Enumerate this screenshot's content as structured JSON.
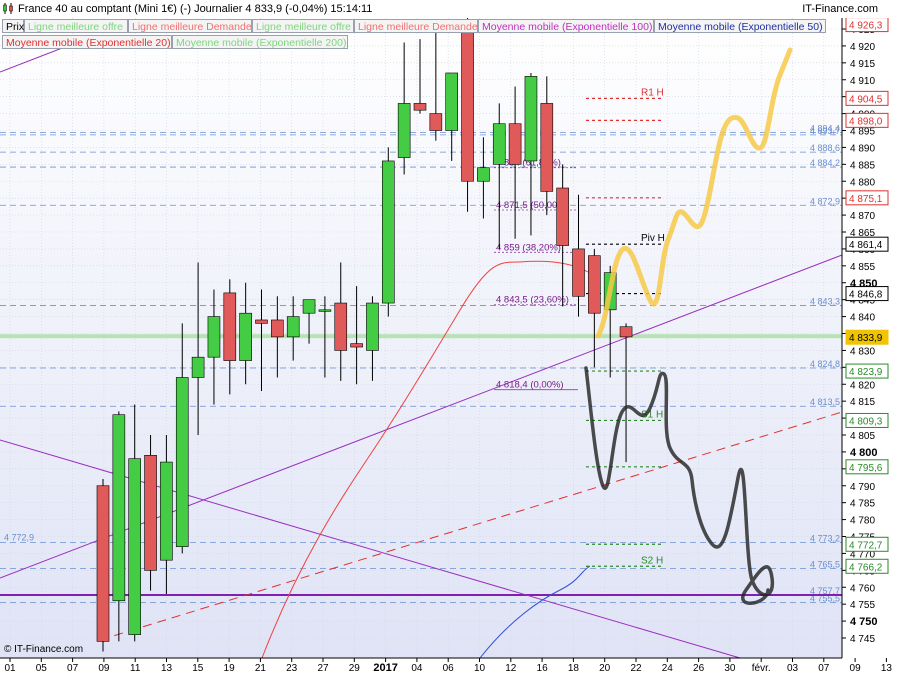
{
  "header": {
    "title": "France 40 au comptant (Mini 1€) (-)   Journalier   4 833,9 (-0,04%)   15:14:11",
    "brand": "IT-Finance.com",
    "copyright": "© IT-Finance.com"
  },
  "legend": [
    {
      "label": "Prix",
      "color": "#000000"
    },
    {
      "label": "Ligne meilleure offre",
      "color": "#7cd67c"
    },
    {
      "label": "Ligne meilleure Demande",
      "color": "#f07070"
    },
    {
      "label": "Ligne meilleure offre",
      "color": "#7cd67c"
    },
    {
      "label": "Ligne meilleure Demande",
      "color": "#f07070"
    },
    {
      "label": "Moyenne mobile (Exponentielle 100)",
      "color": "#c030c0"
    },
    {
      "label": "Moyenne mobile (Exponentielle 50)",
      "color": "#2030a0"
    },
    {
      "label": "Moyenne mobile (Exponentielle 20)",
      "color": "#e03030"
    },
    {
      "label": "Moyenne mobile (Exponentielle 200)",
      "color": "#7cd67c"
    }
  ],
  "chart_data": {
    "type": "candlestick",
    "ylim": [
      4741,
      4929
    ],
    "y_ticks": [
      4745,
      4750,
      4755,
      4760,
      4765,
      4770,
      4775,
      4780,
      4785,
      4790,
      4795,
      4800,
      4805,
      4810,
      4815,
      4820,
      4825,
      4830,
      4835,
      4840,
      4845,
      4850,
      4855,
      4860,
      4865,
      4870,
      4875,
      4880,
      4885,
      4890,
      4895,
      4900,
      4905,
      4910,
      4915,
      4920,
      4925
    ],
    "y_ticks_bold": [
      4750,
      4800,
      4850
    ],
    "x_ticks": [
      "01",
      "05",
      "07",
      "09",
      "11",
      "13",
      "15",
      "19",
      "21",
      "23",
      "27",
      "29",
      "2017",
      "04",
      "06",
      "10",
      "12",
      "16",
      "18",
      "20",
      "22",
      "24",
      "26",
      "30",
      "févr.",
      "03",
      "07",
      "09",
      "13"
    ],
    "candles": [
      {
        "o": 4790,
        "h": 4792,
        "l": 4741,
        "c": 4744
      },
      {
        "o": 4756,
        "h": 4812,
        "l": 4744,
        "c": 4811
      },
      {
        "o": 4746,
        "h": 4814,
        "l": 4744,
        "c": 4798
      },
      {
        "o": 4799,
        "h": 4805,
        "l": 4759,
        "c": 4765
      },
      {
        "o": 4768,
        "h": 4805,
        "l": 4758,
        "c": 4797
      },
      {
        "o": 4772,
        "h": 4838,
        "l": 4770,
        "c": 4822
      },
      {
        "o": 4822,
        "h": 4856,
        "l": 4805,
        "c": 4828
      },
      {
        "o": 4828,
        "h": 4848,
        "l": 4814,
        "c": 4840
      },
      {
        "o": 4847,
        "h": 4851,
        "l": 4817,
        "c": 4827
      },
      {
        "o": 4827,
        "h": 4850,
        "l": 4820,
        "c": 4841
      },
      {
        "o": 4839,
        "h": 4848,
        "l": 4818,
        "c": 4838
      },
      {
        "o": 4839,
        "h": 4846,
        "l": 4822,
        "c": 4834
      },
      {
        "o": 4834,
        "h": 4846,
        "l": 4827,
        "c": 4840
      },
      {
        "o": 4841,
        "h": 4844,
        "l": 4832,
        "c": 4845
      },
      {
        "o": 4842,
        "h": 4846,
        "l": 4822,
        "c": 4842
      },
      {
        "o": 4844,
        "h": 4856,
        "l": 4821,
        "c": 4830
      },
      {
        "o": 4832,
        "h": 4849,
        "l": 4820,
        "c": 4831
      },
      {
        "o": 4830,
        "h": 4846,
        "l": 4821,
        "c": 4844
      },
      {
        "o": 4844,
        "h": 4890,
        "l": 4840,
        "c": 4886
      },
      {
        "o": 4887,
        "h": 4921,
        "l": 4882,
        "c": 4903
      },
      {
        "o": 4903,
        "h": 4922,
        "l": 4900,
        "c": 4901
      },
      {
        "o": 4900,
        "h": 4926,
        "l": 4892,
        "c": 4895
      },
      {
        "o": 4895,
        "h": 4911,
        "l": 4886,
        "c": 4912
      },
      {
        "o": 4926,
        "h": 4930,
        "l": 4871,
        "c": 4880
      },
      {
        "o": 4880,
        "h": 4893,
        "l": 4869,
        "c": 4884
      },
      {
        "o": 4885,
        "h": 4903,
        "l": 4860,
        "c": 4897
      },
      {
        "o": 4897,
        "h": 4908,
        "l": 4863,
        "c": 4885
      },
      {
        "o": 4886,
        "h": 4912,
        "l": 4864,
        "c": 4911
      },
      {
        "o": 4903,
        "h": 4911,
        "l": 4870,
        "c": 4877
      },
      {
        "o": 4878,
        "h": 4885,
        "l": 4843,
        "c": 4861
      },
      {
        "o": 4860,
        "h": 4876,
        "l": 4840,
        "c": 4846
      },
      {
        "o": 4858,
        "h": 4860,
        "l": 4825,
        "c": 4841
      },
      {
        "o": 4842,
        "h": 4855,
        "l": 4822,
        "c": 4853
      },
      {
        "o": 4837,
        "h": 4838,
        "l": 4797,
        "c": 4834
      }
    ],
    "hlines": [
      {
        "value": 4894.4,
        "label": "4 894,4",
        "color": "#6a8fd0"
      },
      {
        "value": 4893.7,
        "label": "4 893,7",
        "color": "#6a8fd0"
      },
      {
        "value": 4888.6,
        "label": "4 888,6",
        "color": "#6a8fd0"
      },
      {
        "value": 4884.2,
        "label": "4 884,2",
        "color": "#6a8fd0"
      },
      {
        "value": 4872.9,
        "label": "4 872,9",
        "color": "#6a8fd0"
      },
      {
        "value": 4843.3,
        "label": "4 843,3",
        "color": "#6a8fd0"
      },
      {
        "value": 4824.8,
        "label": "4 824,8",
        "color": "#6a8fd0"
      },
      {
        "value": 4813.5,
        "label": "4 813,5",
        "color": "#6a8fd0"
      },
      {
        "value": 4773.2,
        "label": "4 773,2",
        "color": "#6a8fd0"
      },
      {
        "value": 4765.5,
        "label": "4 765,5",
        "color": "#6a8fd0"
      },
      {
        "value": 4757.7,
        "label": "4 757,7",
        "color": "#6a8fd0"
      },
      {
        "value": 4755.5,
        "label": "4 755,5",
        "color": "#6a8fd0"
      }
    ],
    "left_label": {
      "value": 4772.9,
      "label": "4 772,9"
    },
    "price_tags": [
      {
        "value": 4926.3,
        "label": "4 926,3",
        "color": "#e03030"
      },
      {
        "value": 4904.5,
        "label": "4 904,5",
        "color": "#e03030"
      },
      {
        "value": 4898.0,
        "label": "4 898,0",
        "color": "#e03030"
      },
      {
        "value": 4875.1,
        "label": "4 875,1",
        "color": "#e03030"
      },
      {
        "value": 4861.4,
        "label": "4 861,4",
        "color": "#000000"
      },
      {
        "value": 4846.8,
        "label": "4 846,8",
        "color": "#000000"
      },
      {
        "value": 4833.9,
        "label": "4 833,9",
        "color": "#f0c400"
      },
      {
        "value": 4823.9,
        "label": "4 823,9",
        "color": "#2a8a2a"
      },
      {
        "value": 4809.3,
        "label": "4 809,3",
        "color": "#2a8a2a"
      },
      {
        "value": 4795.6,
        "label": "4 795,6",
        "color": "#2a8a2a"
      },
      {
        "value": 4772.7,
        "label": "4 772,7",
        "color": "#2a8a2a"
      },
      {
        "value": 4766.2,
        "label": "4 766,2",
        "color": "#2a8a2a"
      }
    ],
    "fibo": [
      {
        "value": 4884.0,
        "label": "4 884 (61,80%)"
      },
      {
        "value": 4871.5,
        "label": "4 871,5 (50,00%)"
      },
      {
        "value": 4859.0,
        "label": "4 859 (38,20%)"
      },
      {
        "value": 4843.5,
        "label": "4 843,5 (23,60%)"
      },
      {
        "value": 4818.4,
        "label": "4 818,4 (0,00%)"
      }
    ],
    "pivots": [
      {
        "value": 4904.5,
        "label": "R1 H",
        "color": "#e03030"
      },
      {
        "value": 4898.0,
        "label": "",
        "color": "#e03030"
      },
      {
        "value": 4875.1,
        "label": "",
        "color": "#e03030"
      },
      {
        "value": 4861.4,
        "label": "Piv H",
        "color": "#000000"
      },
      {
        "value": 4846.8,
        "label": "",
        "color": "#000000"
      },
      {
        "value": 4823.9,
        "label": "",
        "color": "#2a8a2a"
      },
      {
        "value": 4809.3,
        "label": "S1 H",
        "color": "#2a8a2a"
      },
      {
        "value": 4795.6,
        "label": "",
        "color": "#2a8a2a"
      },
      {
        "value": 4772.7,
        "label": "",
        "color": "#2a8a2a"
      },
      {
        "value": 4766.2,
        "label": "S2 H",
        "color": "#2a8a2a"
      }
    ],
    "ema20": [
      [
        14,
        4798
      ],
      [
        15,
        4812
      ],
      [
        16,
        4826
      ],
      [
        17,
        4835
      ],
      [
        18,
        4842
      ],
      [
        19,
        4848
      ],
      [
        20,
        4852
      ],
      [
        21,
        4855
      ],
      [
        22,
        4856
      ],
      [
        23,
        4856
      ],
      [
        24,
        4855
      ],
      [
        25,
        4853
      ],
      [
        26,
        4851
      ]
    ],
    "ema50": [
      [
        13,
        4744
      ],
      [
        14,
        4753
      ],
      [
        15,
        4760
      ],
      [
        16,
        4765
      ],
      [
        17,
        4770
      ],
      [
        18,
        4775
      ],
      [
        19,
        4782
      ],
      [
        20,
        4790
      ],
      [
        21,
        4796
      ],
      [
        22,
        4802
      ],
      [
        23,
        4808
      ],
      [
        24,
        4813
      ],
      [
        25,
        4818
      ],
      [
        26,
        4822
      ],
      [
        27,
        4826
      ],
      [
        28,
        4829
      ],
      [
        29,
        4831
      ],
      [
        30,
        4834
      ],
      [
        31,
        4834
      ],
      [
        32,
        4835
      ],
      [
        33,
        4833
      ]
    ],
    "ema100": [
      [
        31,
        4755
      ],
      [
        32,
        4760
      ],
      [
        33,
        4766
      ],
      [
        34,
        4773
      ]
    ]
  }
}
